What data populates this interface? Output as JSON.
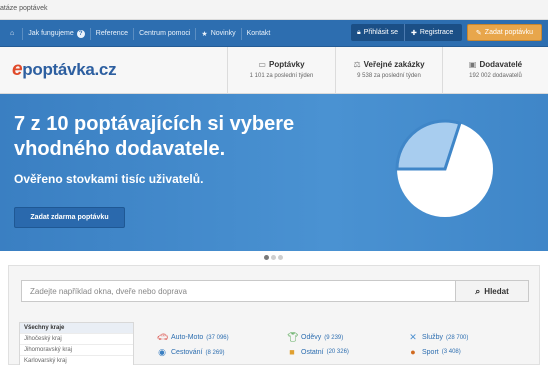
{
  "browser": {
    "tab_title": "atáze poptávek"
  },
  "nav": {
    "items": [
      {
        "icon": "home-icon",
        "label": ""
      },
      {
        "icon": "",
        "label": "Jak fungujeme"
      },
      {
        "icon": "",
        "label": "Reference"
      },
      {
        "icon": "",
        "label": "Centrum pomoci"
      },
      {
        "icon": "star-icon",
        "label": "Novinky"
      },
      {
        "icon": "",
        "label": "Kontakt"
      }
    ],
    "login_label": "Přihlásit se",
    "register_label": "Registrace",
    "cta_label": "Zadat poptávku"
  },
  "header": {
    "logo_e": "e",
    "logo_rest": "poptávka.cz",
    "stats": [
      {
        "icon": "inbox-icon",
        "title": "Poptávky",
        "sub": "1 101 za poslední týden"
      },
      {
        "icon": "scale-icon",
        "title": "Veřejné zakázky",
        "sub": "9 538 za poslední týden"
      },
      {
        "icon": "briefcase-icon",
        "title": "Dodavatelé",
        "sub": "192 002 dodavatelů"
      }
    ]
  },
  "hero": {
    "line1": "7 z 10 poptávajících si vybere",
    "line2": "vhodného dodavatele.",
    "subtitle": "Ověřeno stovkami tisíc uživatelů.",
    "button_label": "Zadat zdarma poptávku",
    "pie_fraction": 0.7
  },
  "slider": {
    "active_index": 0,
    "count": 3
  },
  "search": {
    "placeholder": "Zadejte například okna, dveře nebo doprava",
    "value": "",
    "button_label": "Hledat"
  },
  "regions": [
    "Všechny kraje",
    "Jihočeský kraj",
    "Jihomoravský kraj",
    "Karlovarský kraj"
  ],
  "categories": [
    {
      "icon": "car-icon",
      "name": "Auto-Moto",
      "count": "(37 096)",
      "color": "#d9413a"
    },
    {
      "icon": "shirt-icon",
      "name": "Oděvy",
      "count": "(9 239)",
      "color": "#3a9a3a"
    },
    {
      "icon": "tools-icon",
      "name": "Služby",
      "count": "(28 700)",
      "color": "#4a8fd0"
    },
    {
      "icon": "globe-icon",
      "name": "Cestování",
      "count": "(8 269)",
      "color": "#3a7fc2"
    },
    {
      "icon": "box-icon",
      "name": "Ostatní",
      "count": "(20 326)",
      "color": "#e0a030"
    },
    {
      "icon": "ball-icon",
      "name": "Sport",
      "count": "(3 408)",
      "color": "#d06a20"
    }
  ],
  "colors": {
    "nav_bg": "#2d6eb0",
    "cta": "#e8a64b",
    "hero_bg": "#3f86c8",
    "link": "#2d6eb0"
  }
}
